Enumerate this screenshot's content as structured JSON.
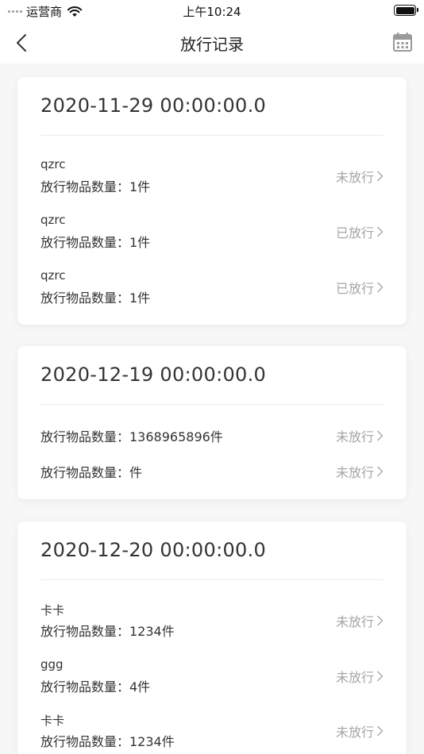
{
  "status_bar": {
    "carrier": "运营商",
    "time": "上午10:24"
  },
  "nav": {
    "title": "放行记录"
  },
  "groups": [
    {
      "date": "2020-11-29 00:00:00.0",
      "records": [
        {
          "name": "qzrc",
          "qty": "放行物品数量：1件",
          "status": "未放行"
        },
        {
          "name": "qzrc",
          "qty": "放行物品数量：1件",
          "status": "已放行"
        },
        {
          "name": "qzrc",
          "qty": "放行物品数量：1件",
          "status": "已放行"
        }
      ]
    },
    {
      "date": "2020-12-19 00:00:00.0",
      "records": [
        {
          "name": "",
          "qty": "放行物品数量：1368965896件",
          "status": "未放行"
        },
        {
          "name": "",
          "qty": "放行物品数量：件",
          "status": "未放行"
        }
      ]
    },
    {
      "date": "2020-12-20 00:00:00.0",
      "records": [
        {
          "name": "卡卡",
          "qty": "放行物品数量：1234件",
          "status": "未放行"
        },
        {
          "name": "ggg",
          "qty": "放行物品数量：4件",
          "status": "未放行"
        },
        {
          "name": "卡卡",
          "qty": "放行物品数量：1234件",
          "status": "未放行"
        }
      ]
    }
  ]
}
